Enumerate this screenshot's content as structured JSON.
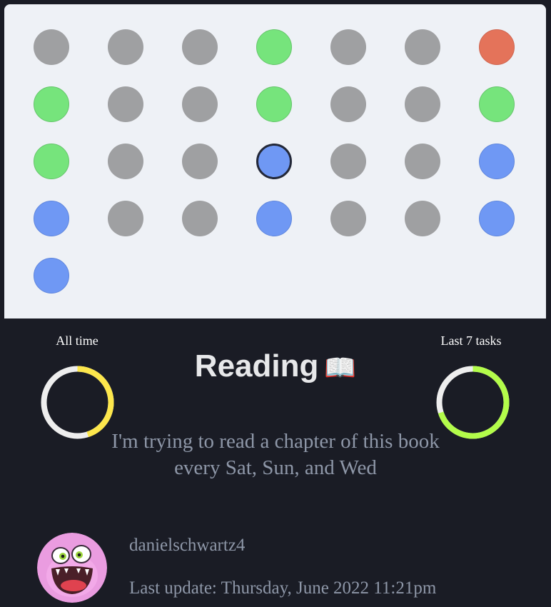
{
  "grid": {
    "rows": [
      [
        "gray",
        "gray",
        "gray",
        "green",
        "gray",
        "gray",
        "red"
      ],
      [
        "green",
        "gray",
        "gray",
        "green",
        "gray",
        "gray",
        "green"
      ],
      [
        "green",
        "gray",
        "gray",
        "blue",
        "gray",
        "gray",
        "blue"
      ],
      [
        "blue",
        "gray",
        "gray",
        "blue",
        "gray",
        "gray",
        "blue"
      ],
      [
        "blue"
      ]
    ],
    "selected": [
      2,
      3
    ],
    "colors": {
      "gray": "#9fa0a2",
      "green": "#76e47c",
      "blue": "#6f98f4",
      "red": "#e4735a"
    }
  },
  "stats": {
    "all_time": {
      "label": "All time",
      "progress": 0.45,
      "color": "#fde74c"
    },
    "last_7": {
      "label": "Last 7 tasks",
      "progress": 0.7,
      "color": "#b3fc4a"
    }
  },
  "habit": {
    "title": "Reading",
    "emoji": "📖",
    "description": "I'm trying to read a chapter of this book every Sat, Sun, and Wed"
  },
  "user": {
    "username": "danielschwartz4",
    "last_update": "Last update: Thursday, June 2022 11:21pm",
    "avatar_icon": "pink-monster-avatar-icon"
  }
}
